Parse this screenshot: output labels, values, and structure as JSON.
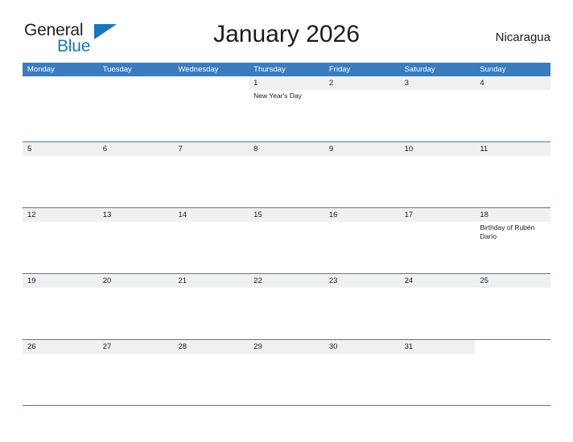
{
  "brand": {
    "word_one": "General",
    "word_two": "Blue",
    "triangle_icon": "logo-triangle-icon"
  },
  "header": {
    "title": "January 2026",
    "region": "Nicaragua"
  },
  "calendar": {
    "weekday_headers": [
      "Monday",
      "Tuesday",
      "Wednesday",
      "Thursday",
      "Friday",
      "Saturday",
      "Sunday"
    ],
    "colors": {
      "header_blue": "#3a7cbe",
      "band_gray": "#f0f0f0",
      "rule_blue": "#4a7ba8",
      "brand_blue": "#1b75bb",
      "text": "#1a1a1a"
    },
    "weeks": [
      [
        {
          "num": "",
          "event": ""
        },
        {
          "num": "",
          "event": ""
        },
        {
          "num": "",
          "event": ""
        },
        {
          "num": "1",
          "event": "New Year's Day"
        },
        {
          "num": "2",
          "event": ""
        },
        {
          "num": "3",
          "event": ""
        },
        {
          "num": "4",
          "event": ""
        }
      ],
      [
        {
          "num": "5",
          "event": ""
        },
        {
          "num": "6",
          "event": ""
        },
        {
          "num": "7",
          "event": ""
        },
        {
          "num": "8",
          "event": ""
        },
        {
          "num": "9",
          "event": ""
        },
        {
          "num": "10",
          "event": ""
        },
        {
          "num": "11",
          "event": ""
        }
      ],
      [
        {
          "num": "12",
          "event": ""
        },
        {
          "num": "13",
          "event": ""
        },
        {
          "num": "14",
          "event": ""
        },
        {
          "num": "15",
          "event": ""
        },
        {
          "num": "16",
          "event": ""
        },
        {
          "num": "17",
          "event": ""
        },
        {
          "num": "18",
          "event": "Birthday of Rubén Darío"
        }
      ],
      [
        {
          "num": "19",
          "event": ""
        },
        {
          "num": "20",
          "event": ""
        },
        {
          "num": "21",
          "event": ""
        },
        {
          "num": "22",
          "event": ""
        },
        {
          "num": "23",
          "event": ""
        },
        {
          "num": "24",
          "event": ""
        },
        {
          "num": "25",
          "event": ""
        }
      ],
      [
        {
          "num": "26",
          "event": ""
        },
        {
          "num": "27",
          "event": ""
        },
        {
          "num": "28",
          "event": ""
        },
        {
          "num": "29",
          "event": ""
        },
        {
          "num": "30",
          "event": ""
        },
        {
          "num": "31",
          "event": ""
        },
        {
          "num": "",
          "event": ""
        }
      ]
    ]
  }
}
